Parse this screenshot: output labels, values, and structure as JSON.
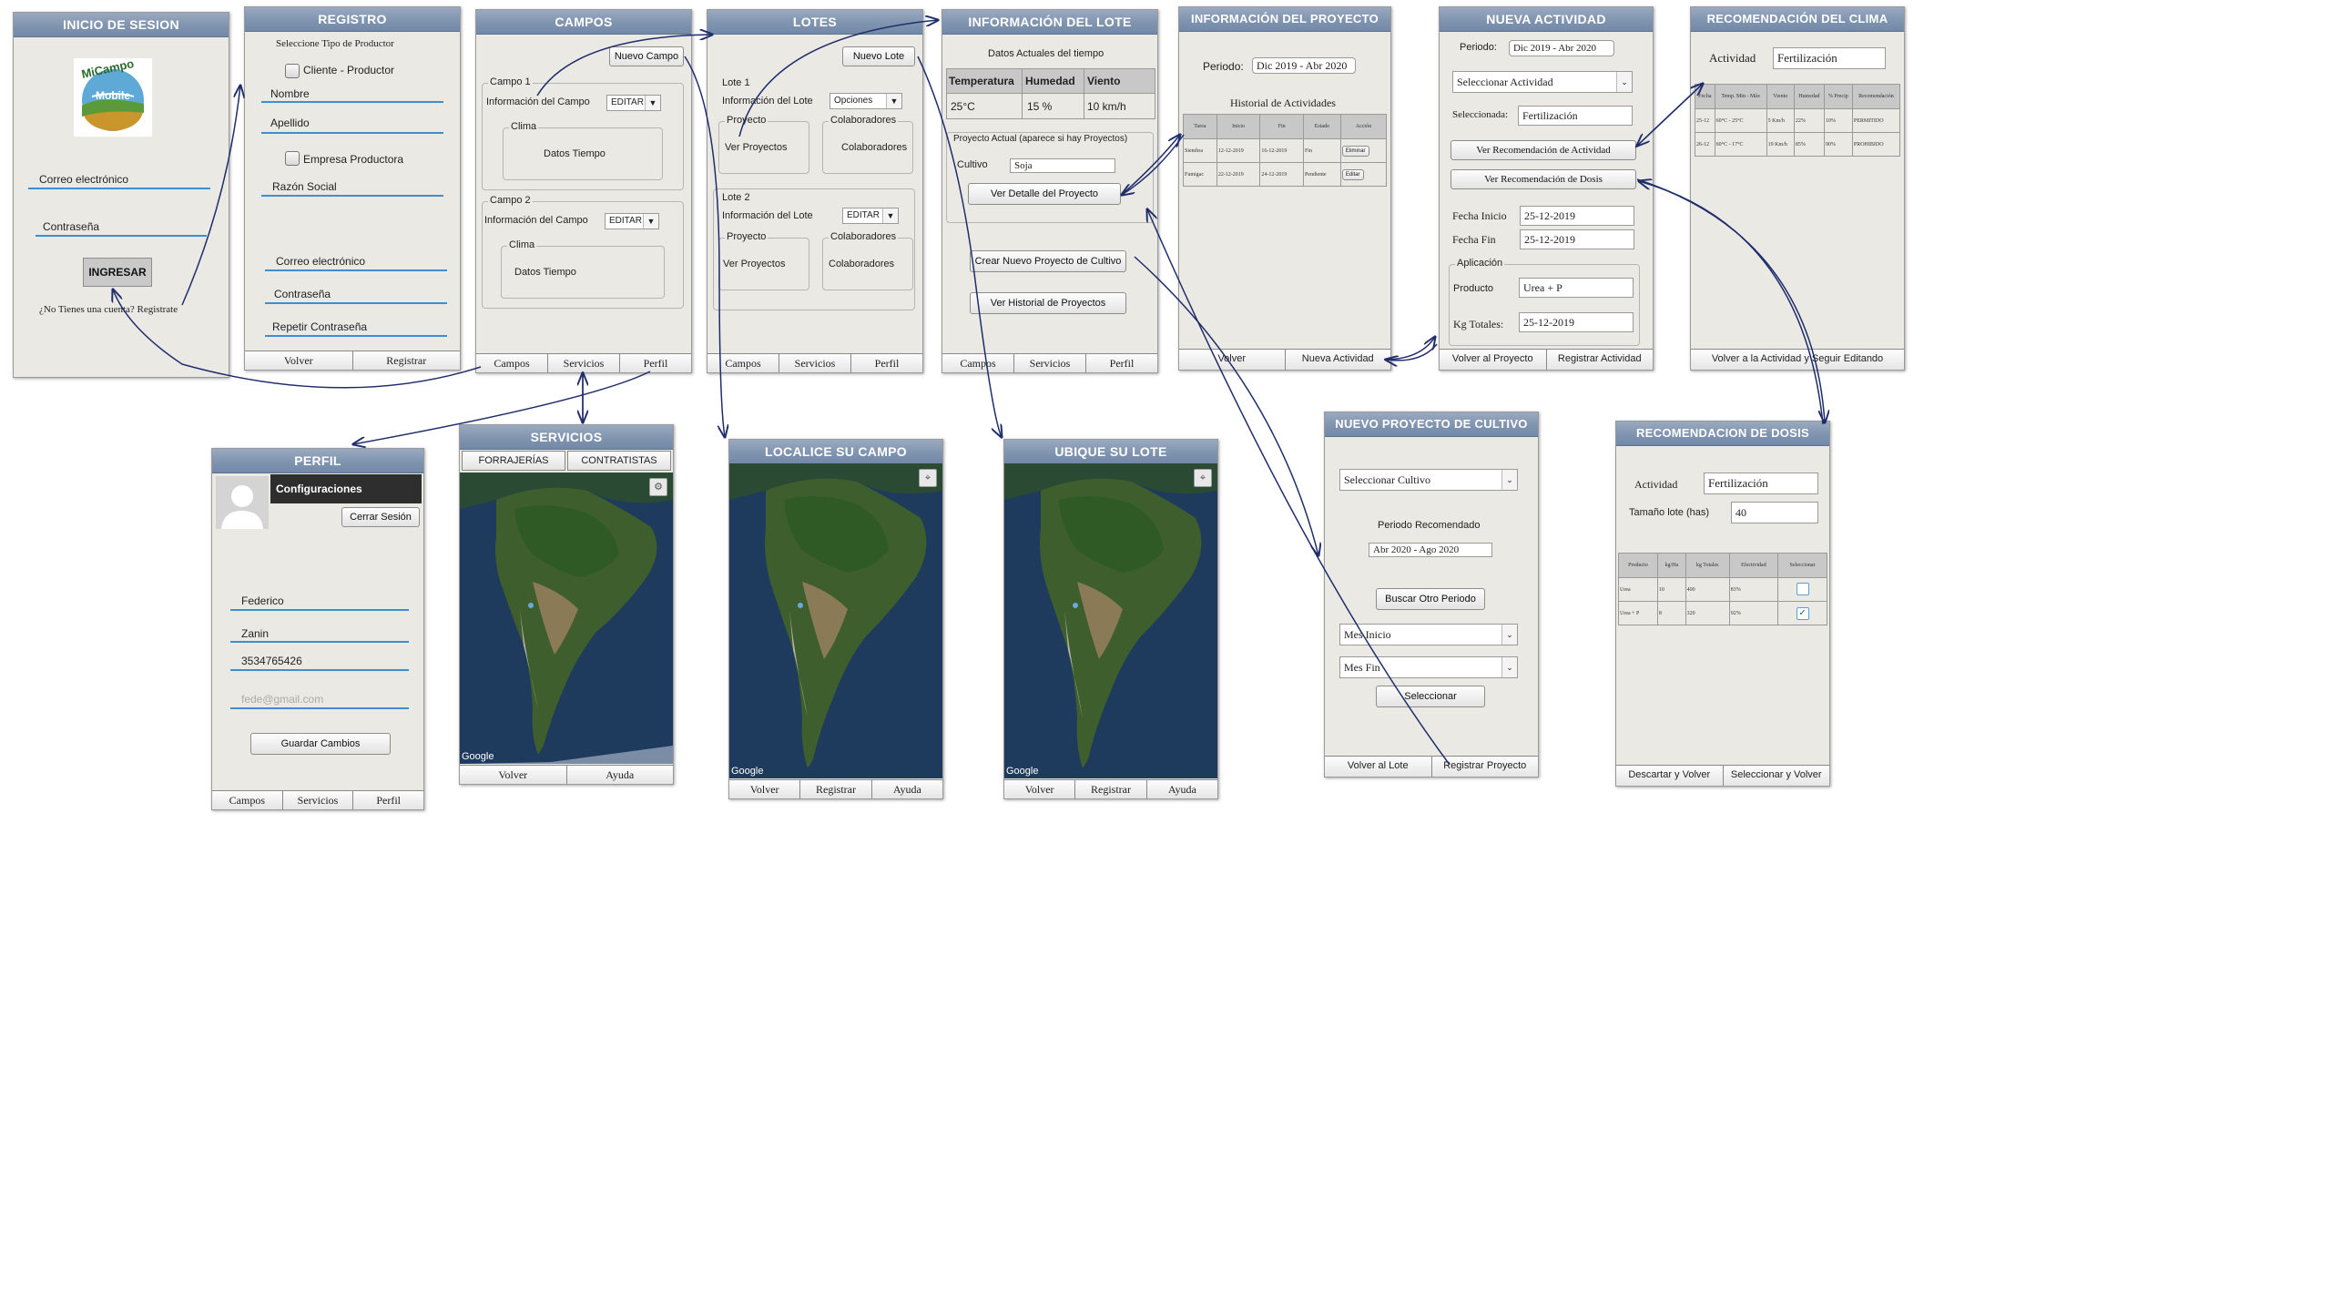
{
  "login": {
    "title": "INICIO DE SESION",
    "logo_top": "MiCampo",
    "logo_bottom": "Mobile",
    "email": "Correo electrónico",
    "password": "Contraseña",
    "button": "INGRESAR",
    "register_text": "¿No Tienes una cuenta? Registrate"
  },
  "registro": {
    "title": "REGISTRO",
    "select_type": "Seleccione Tipo de Productor",
    "client": "Cliente - Productor",
    "nombre": "Nombre",
    "apellido": "Apellido",
    "empresa": "Empresa Productora",
    "razon": "Razón Social",
    "email": "Correo electrónico",
    "password": "Contraseña",
    "repeat": "Repetir Contraseña",
    "nav": [
      "Volver",
      "Registrar"
    ]
  },
  "campos": {
    "title": "CAMPOS",
    "new_button": "Nuevo Campo",
    "campo1": "Campo 1",
    "campo2": "Campo 2",
    "info": "Información del Campo",
    "edit": "EDITAR",
    "clima": "Clima",
    "datos": "Datos Tiempo",
    "nav": [
      "Campos",
      "Servicios",
      "Perfil"
    ]
  },
  "lotes": {
    "title": "LOTES",
    "new_button": "Nuevo Lote",
    "lote1": "Lote 1",
    "lote2": "Lote 2",
    "info": "Información del Lote",
    "opciones": "Opciones",
    "editar": "EDITAR",
    "proyecto": "Proyecto",
    "ver_proyectos": "Ver Proyectos",
    "colab": "Colaboradores",
    "nav": [
      "Campos",
      "Servicios",
      "Perfil"
    ]
  },
  "info_lote": {
    "title": "INFORMACIÓN DEL LOTE",
    "subtitle": "Datos Actuales del tiempo",
    "headers": [
      "Temperatura",
      "Humedad",
      "Viento"
    ],
    "values": [
      "25°C",
      "15 %",
      "10 km/h"
    ],
    "proyecto_actual": "Proyecto Actual (aparece si hay Proyectos)",
    "cultivo_label": "Cultivo",
    "cultivo_value": "Soja",
    "ver_detalle": "Ver Detalle del Proyecto",
    "crear": "Crear Nuevo Proyecto de Cultivo",
    "historial": "Ver Historial de Proyectos",
    "nav": [
      "Campos",
      "Servicios",
      "Perfil"
    ]
  },
  "info_proyecto": {
    "title": "INFORMACIÓN DEL PROYECTO",
    "periodo_label": "Periodo:",
    "periodo": "Dic 2019 - Abr 2020",
    "historial": "Historial de Actividades",
    "headers": [
      "Tarea",
      "Inicio",
      "Fin",
      "Estado",
      "Acción"
    ],
    "rows": [
      [
        "Siembra",
        "12-12-2019",
        "16-12-2019",
        "Fin",
        "Eliminar"
      ],
      [
        "Fumigac",
        "22-12-2019",
        "24-12-2019",
        "Pendiente",
        "Editar"
      ]
    ],
    "nav": [
      "Volver",
      "Nueva Actividad"
    ]
  },
  "nueva_actividad": {
    "title": "NUEVA ACTIVIDAD",
    "periodo_label": "Periodo:",
    "periodo": "Dic 2019 - Abr 2020",
    "select": "Seleccionar Actividad",
    "seleccionada_label": "Seleccionada:",
    "seleccionada": "Fertilización",
    "ver_rec_act": "Ver Recomendación de Actividad",
    "ver_rec_dosis": "Ver Recomendación de Dosis",
    "fecha_inicio_label": "Fecha Inicio",
    "fecha_inicio": "25-12-2019",
    "fecha_fin_label": "Fecha Fin",
    "fecha_fin": "25-12-2019",
    "aplicacion": "Aplicación",
    "producto_label": "Producto",
    "producto": "Urea + P",
    "kg_label": "Kg Totales:",
    "kg": "25-12-2019",
    "nav": [
      "Volver al Proyecto",
      "Registrar Actividad"
    ]
  },
  "rec_clima": {
    "title": "RECOMENDACIÓN DEL CLIMA",
    "actividad_label": "Actividad",
    "actividad": "Fertilización",
    "headers": [
      "Fecha",
      "Temp. Min - Máx",
      "Viento",
      "Humedad",
      "% Precip",
      "Recomendación"
    ],
    "rows": [
      [
        "25-12",
        "60°C - 25°C",
        "5 Km/h",
        "22%",
        "10%",
        "PERMITIDO"
      ],
      [
        "26-12",
        "60°C - 17°C",
        "19 Km/h",
        "85%",
        "90%",
        "PROHIBIDO"
      ]
    ],
    "nav": [
      "Volver a la Actividad y Seguir Editando"
    ]
  },
  "perfil": {
    "title": "PERFIL",
    "config": "Configuraciones",
    "cerrar": "Cerrar Sesión",
    "nombre": "Federico",
    "apellido": "Zanin",
    "telefono": "3534765426",
    "email": "fede@gmail.com",
    "guardar": "Guardar Cambios",
    "nav": [
      "Campos",
      "Servicios",
      "Perfil"
    ]
  },
  "servicios": {
    "title": "SERVICIOS",
    "tabs": [
      "FORRAJERÍAS",
      "CONTRATISTAS"
    ],
    "google": "Google",
    "nav": [
      "Volver",
      "Ayuda"
    ]
  },
  "localice": {
    "title": "LOCALICE SU CAMPO",
    "google": "Google",
    "nav": [
      "Volver",
      "Registrar",
      "Ayuda"
    ]
  },
  "ubique": {
    "title": "UBIQUE SU LOTE",
    "google": "Google",
    "nav": [
      "Volver",
      "Registrar",
      "Ayuda"
    ]
  },
  "nuevo_proyecto": {
    "title": "NUEVO PROYECTO DE CULTIVO",
    "select": "Seleccionar Cultivo",
    "periodo_label": "Periodo Recomendado",
    "periodo": "Abr 2020 - Ago 2020",
    "buscar": "Buscar Otro Periodo",
    "mes_inicio": "Mes Inicio",
    "mes_fin": "Mes Fin",
    "seleccionar": "Seleccionar",
    "nav": [
      "Volver al Lote",
      "Registrar Proyecto"
    ]
  },
  "rec_dosis": {
    "title": "RECOMENDACION DE DOSIS",
    "actividad_label": "Actividad",
    "actividad": "Fertilización",
    "tamano_label": "Tamaño lote (has)",
    "tamano": "40",
    "headers": [
      "Producto",
      "kg/Ha",
      "kg Totales",
      "Efectividad",
      "Seleccionar"
    ],
    "rows": [
      [
        "Urea",
        "10",
        "400",
        "83%"
      ],
      [
        "Urea + P",
        "8",
        "320",
        "92%"
      ]
    ],
    "nav": [
      "Descartar y Volver",
      "Seleccionar y Volver"
    ]
  },
  "colors": {
    "title_bar": "#8094b0",
    "screen_bg": "#ebe9e4",
    "arrow": "#1f2d6b",
    "underline": "#3d8fd1"
  }
}
